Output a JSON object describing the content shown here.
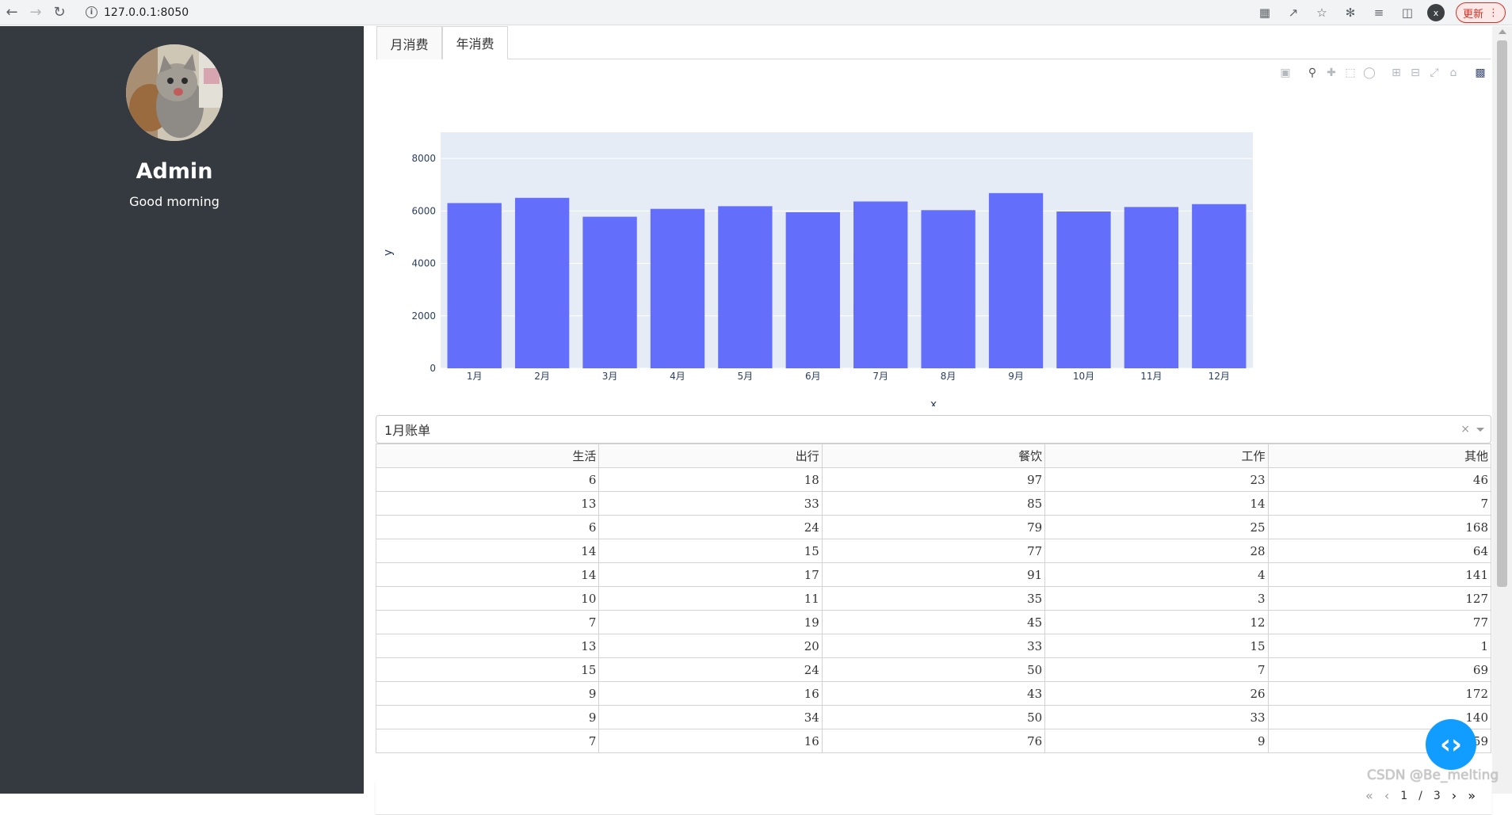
{
  "browser": {
    "url": "127.0.0.1:8050",
    "profile_initial": "x",
    "update_label": "更新"
  },
  "sidebar": {
    "name": "Admin",
    "greeting": "Good morning"
  },
  "tabs": [
    {
      "label": "月消费",
      "active": false
    },
    {
      "label": "年消费",
      "active": true
    }
  ],
  "chart_data": {
    "type": "bar",
    "categories": [
      "1月",
      "2月",
      "3月",
      "4月",
      "5月",
      "6月",
      "7月",
      "8月",
      "9月",
      "10月",
      "11月",
      "12月"
    ],
    "values": [
      6300,
      6500,
      5780,
      6080,
      6180,
      5950,
      6360,
      6030,
      6680,
      5980,
      6150,
      6260
    ],
    "xlabel": "x",
    "ylabel": "y",
    "ylim": [
      0,
      9000
    ],
    "yticks": [
      0,
      2000,
      4000,
      6000,
      8000
    ],
    "color": "#636efa",
    "plot_bg": "#e5ecf6"
  },
  "dropdown": {
    "selected": "1月账单"
  },
  "table": {
    "columns": [
      "生活",
      "出行",
      "餐饮",
      "工作",
      "其他"
    ],
    "rows": [
      [
        "6",
        "18",
        "97",
        "23",
        "46"
      ],
      [
        "13",
        "33",
        "85",
        "14",
        "7"
      ],
      [
        "6",
        "24",
        "79",
        "25",
        "168"
      ],
      [
        "14",
        "15",
        "77",
        "28",
        "64"
      ],
      [
        "14",
        "17",
        "91",
        "4",
        "141"
      ],
      [
        "10",
        "11",
        "35",
        "3",
        "127"
      ],
      [
        "7",
        "19",
        "45",
        "12",
        "77"
      ],
      [
        "13",
        "20",
        "33",
        "15",
        "1"
      ],
      [
        "15",
        "24",
        "50",
        "7",
        "69"
      ],
      [
        "9",
        "16",
        "43",
        "26",
        "172"
      ],
      [
        "9",
        "34",
        "50",
        "33",
        "140"
      ],
      [
        "7",
        "16",
        "76",
        "9",
        "59"
      ]
    ]
  },
  "pager": {
    "current": "1",
    "separator": "/",
    "total": "3"
  },
  "watermark": "CSDN @Be_melting"
}
